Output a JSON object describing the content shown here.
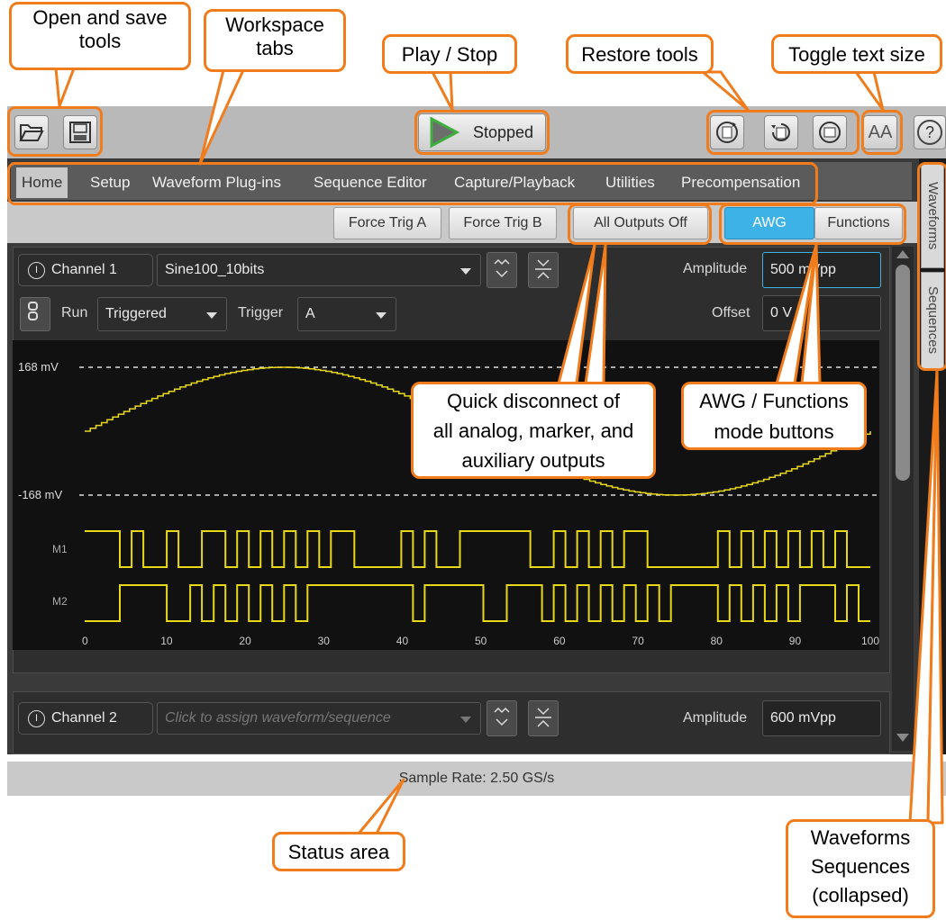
{
  "callouts": {
    "open_save": "Open and save\ntools",
    "workspace_tabs": "Workspace\ntabs",
    "play_stop": "Play / Stop",
    "restore_tools": "Restore tools",
    "toggle_text": "Toggle text size",
    "quick_disconnect": "Quick disconnect of\nall analog, marker, and\nauxiliary outputs",
    "awg_functions": "AWG / Functions\nmode buttons",
    "status_area": "Status area",
    "waveforms_sequences": "Waveforms\nSequences\n(collapsed)"
  },
  "toolbar": {
    "play_status": "Stopped",
    "text_size_label": "AA",
    "help_label": "?"
  },
  "tabs": [
    "Home",
    "Setup",
    "Waveform Plug-ins",
    "Sequence Editor",
    "Capture/Playback",
    "Utilities",
    "Precompensation"
  ],
  "buttons": {
    "force_trig_a": "Force Trig A",
    "force_trig_b": "Force Trig B",
    "all_outputs_off": "All Outputs Off",
    "awg": "AWG",
    "functions": "Functions"
  },
  "channel1": {
    "label": "Channel 1",
    "waveform": "Sine100_10bits",
    "amplitude_label": "Amplitude",
    "amplitude": "500 mVpp",
    "offset_label": "Offset",
    "offset": "0 V",
    "run_label": "Run",
    "run_mode": "Triggered",
    "trigger_label": "Trigger",
    "trigger": "A"
  },
  "channel2": {
    "label": "Channel 2",
    "placeholder": "Click to assign waveform/sequence",
    "amplitude_label": "Amplitude",
    "amplitude": "600 mVpp"
  },
  "plot": {
    "y_top_label": "168 mV",
    "y_bottom_label": "-168 mV",
    "marker1_label": "M1",
    "marker2_label": "M2",
    "x_ticks": [
      "0",
      "10",
      "20",
      "30",
      "40",
      "50",
      "60",
      "70",
      "80",
      "90",
      "100"
    ],
    "trace_color": "#e8d81a",
    "background": "#111111"
  },
  "side_tabs": {
    "waveforms": "Waveforms",
    "sequences": "Sequences"
  },
  "status": {
    "sample_rate": "Sample Rate: 2.50 GS/s"
  },
  "colors": {
    "callout_border": "#f07c1c",
    "awg_active": "#3db2e6",
    "play_green": "#3fae3f"
  }
}
